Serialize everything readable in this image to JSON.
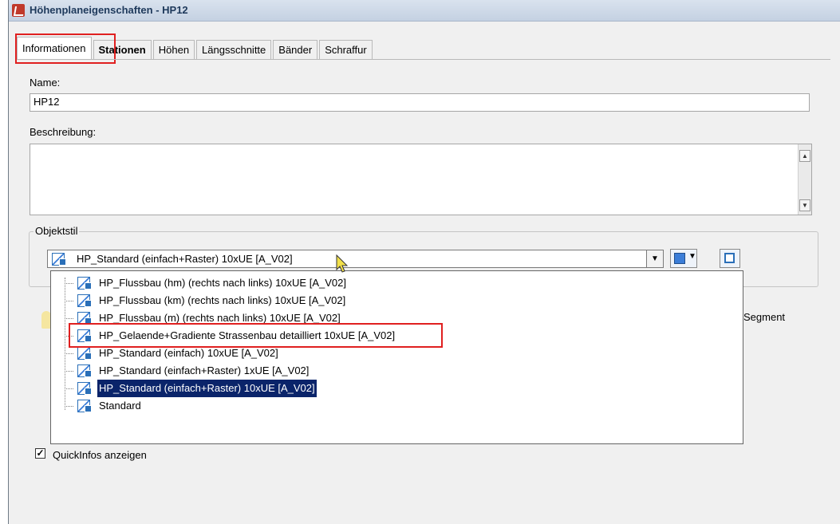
{
  "window": {
    "title": "Höhenplaneigenschaften - HP12",
    "tabs": [
      {
        "label": "Informationen",
        "active": true,
        "bold": false
      },
      {
        "label": "Stationen",
        "active": false,
        "bold": true
      },
      {
        "label": "Höhen",
        "active": false,
        "bold": false
      },
      {
        "label": "Längsschnitte",
        "active": false,
        "bold": false
      },
      {
        "label": "Bänder",
        "active": false,
        "bold": false
      },
      {
        "label": "Schraffur",
        "active": false,
        "bold": false
      }
    ]
  },
  "form": {
    "name_label": "Name:",
    "name_value": "HP12",
    "description_label": "Beschreibung:",
    "description_value": "",
    "objektstil_label": "Objektstil",
    "combo_value": "HP_Standard (einfach+Raster) 10xUE [A_V02]",
    "segment_label": "Segment",
    "quickinfo_label": "QuickInfos anzeigen",
    "quickinfo_checked": true
  },
  "dropdown": {
    "items": [
      {
        "label": "HP_Flussbau (hm) (rechts nach links) 10xUE [A_V02]"
      },
      {
        "label": "HP_Flussbau (km) (rechts nach links) 10xUE [A_V02]"
      },
      {
        "label": "HP_Flussbau (m) (rechts nach links) 10xUE [A_V02]"
      },
      {
        "label": "HP_Gelaende+Gradiente Strassenbau detailliert 10xUE [A_V02]"
      },
      {
        "label": "HP_Standard (einfach) 10xUE [A_V02]"
      },
      {
        "label": "HP_Standard (einfach+Raster)  1xUE [A_V02]"
      },
      {
        "label": "HP_Standard (einfach+Raster) 10xUE [A_V02]"
      },
      {
        "label": "Standard"
      }
    ],
    "selected_index": 6,
    "highlighted_index": 3
  },
  "colors": {
    "highlight_box": "#e02020",
    "selection_bg": "#0a246a"
  }
}
